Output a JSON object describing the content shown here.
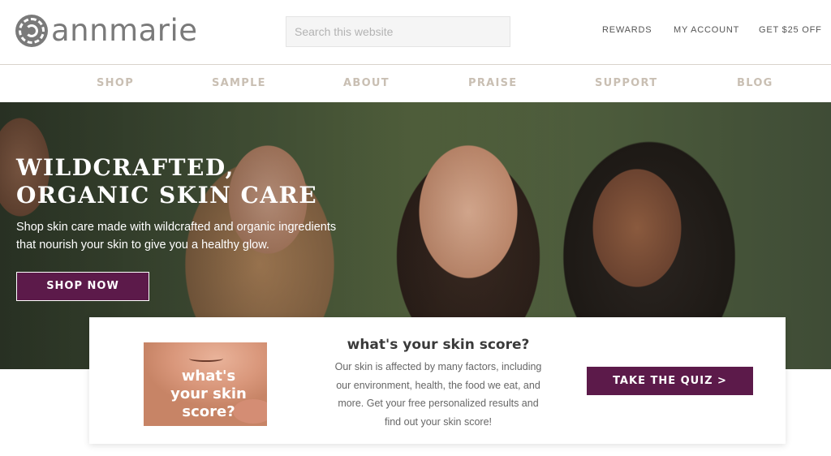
{
  "brand": {
    "name": "annmarie",
    "logo_icon": "spiral-logo-icon"
  },
  "search": {
    "placeholder": "Search this website",
    "value": ""
  },
  "utility_links": [
    "REWARDS",
    "MY ACCOUNT",
    "GET $25 OFF"
  ],
  "nav": [
    "SHOP",
    "SAMPLE",
    "ABOUT",
    "PRAISE",
    "SUPPORT",
    "BLOG"
  ],
  "hero": {
    "title": "WILDCRAFTED, ORGANIC SKIN CARE",
    "subtitle": "Shop skin care made with wildcrafted and organic ingredients that nourish your skin to give you a healthy glow.",
    "cta": "SHOP NOW"
  },
  "quiz": {
    "image_text": "what's your skin score?",
    "title": "what's your skin score?",
    "description": "Our skin is affected by many factors, including our environment, health, the food we eat, and more. Get your free personalized results and find out your skin score!",
    "cta": "TAKE THE QUIZ >"
  },
  "colors": {
    "accent": "#5c1a4a",
    "nav_text": "#c9bfb3",
    "logo": "#7a7a7a"
  }
}
